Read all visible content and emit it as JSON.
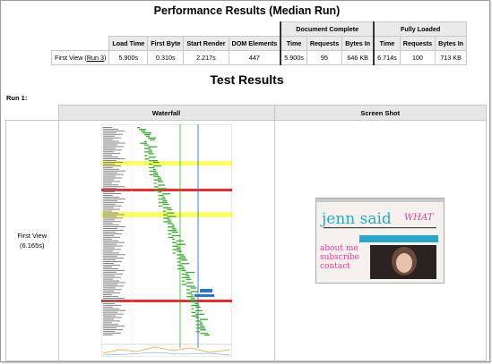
{
  "perf": {
    "title": "Performance Results (Median Run)",
    "group_doc": "Document Complete",
    "group_full": "Fully Loaded",
    "headers": [
      "Load Time",
      "First Byte",
      "Start Render",
      "DOM Elements",
      "Time",
      "Requests",
      "Bytes In",
      "Time",
      "Requests",
      "Bytes In"
    ],
    "row_label_prefix": "First View (",
    "row_label_link": "Run 3",
    "row_label_suffix": ")",
    "values": [
      "5.900s",
      "0.310s",
      "2.217s",
      "447",
      "5.900s",
      "95",
      "646 KB",
      "6.714s",
      "100",
      "713 KB"
    ]
  },
  "results": {
    "title": "Test Results",
    "run_label": "Run 1:",
    "col_waterfall": "Waterfall",
    "col_screenshot": "Screen Shot",
    "view_label": "First View",
    "view_time": "(6.165s)"
  },
  "screenshot": {
    "brand": "jenn said",
    "brand_accent": "WHAT",
    "side_lines": [
      "about me",
      "subscribe",
      "contact"
    ]
  },
  "colors": {
    "bar_green": "#3fa535",
    "bar_blue": "#2a74d6",
    "highlight_yellow": "#ffff66",
    "highlight_red": "#e03030",
    "brand_pink": "#e23a9a",
    "brand_blue": "#2aa6c9"
  }
}
